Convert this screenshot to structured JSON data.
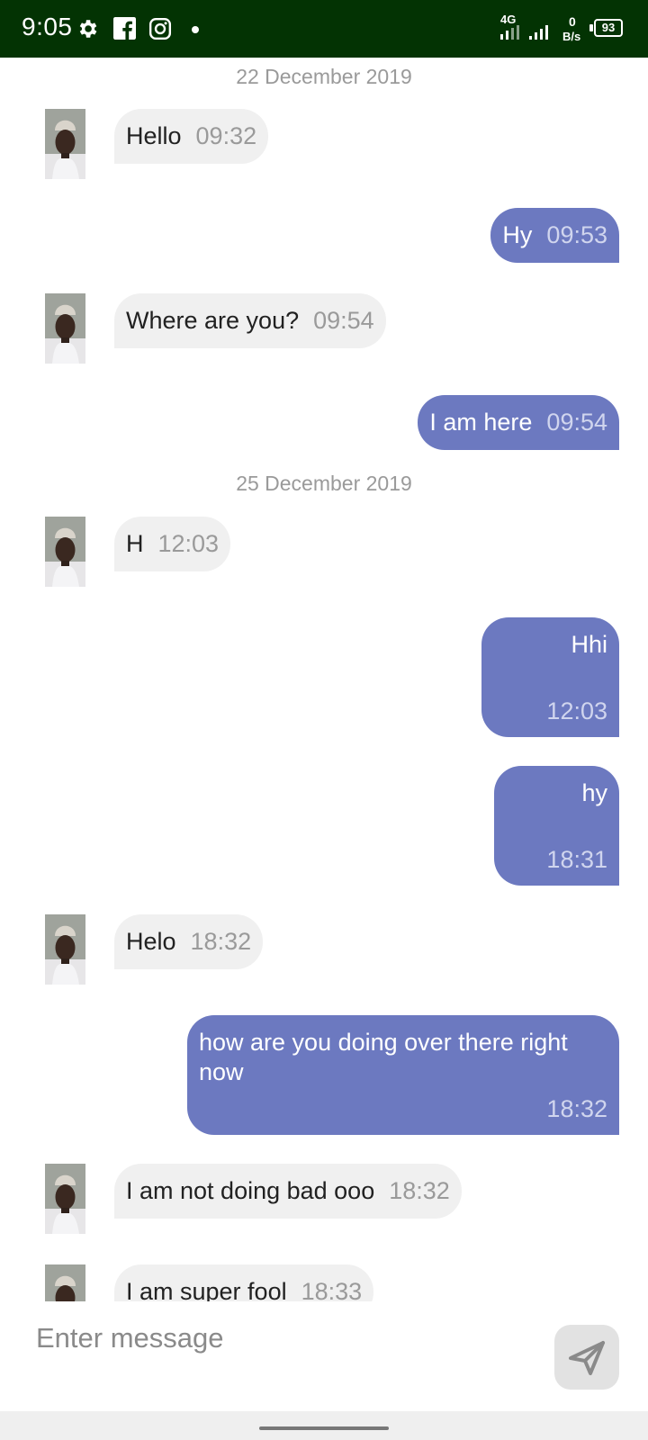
{
  "status_bar": {
    "time": "9:05",
    "network": "4G",
    "speed_value": "0",
    "speed_unit": "B/s",
    "battery": "93",
    "icons": [
      "gear-icon",
      "facebook-icon",
      "instagram-icon",
      "dot-icon",
      "signal-icon",
      "battery-icon"
    ]
  },
  "chat": {
    "date_1": "22 December 2019",
    "date_2": "25 December 2019",
    "messages": [
      {
        "direction": "incoming",
        "text": "Hello",
        "time": "09:32"
      },
      {
        "direction": "outgoing",
        "text": "Hy",
        "time": "09:53"
      },
      {
        "direction": "incoming",
        "text": "Where are you?",
        "time": "09:54"
      },
      {
        "direction": "outgoing",
        "text": "I am here",
        "time": "09:54"
      },
      {
        "direction": "incoming",
        "text": "H",
        "time": "12:03"
      },
      {
        "direction": "outgoing",
        "text": "Hhi",
        "time": "12:03"
      },
      {
        "direction": "outgoing",
        "text": "hy",
        "time": "18:31"
      },
      {
        "direction": "incoming",
        "text": "Helo",
        "time": "18:32"
      },
      {
        "direction": "outgoing",
        "text": "how are you doing over there right now",
        "time": "18:32"
      },
      {
        "direction": "incoming",
        "text": "I am not doing bad ooo",
        "time": "18:32"
      },
      {
        "direction": "incoming",
        "text": "I am super fool",
        "time": "18:33"
      }
    ]
  },
  "composer": {
    "placeholder": "Enter message",
    "send_icon": "send-icon"
  },
  "colors": {
    "status_bar": "#033303",
    "outgoing_bubble": "#6c79c0",
    "incoming_bubble": "#f0f0f0",
    "date_text": "#9a9a9a"
  }
}
